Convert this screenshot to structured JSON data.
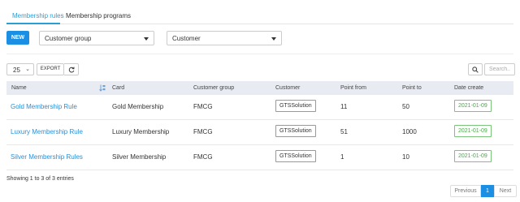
{
  "tabs": [
    {
      "label": "Membership rules",
      "active": true
    },
    {
      "label": "Membership programs",
      "active": false
    }
  ],
  "toolbar": {
    "new_label": "NEW",
    "customer_group_select": "Customer group",
    "customer_select": "Customer"
  },
  "table_controls": {
    "page_size": "25",
    "export_label": "EXPORT",
    "search_placeholder": "Search...",
    "refresh_icon": "refresh-icon",
    "search_icon": "search-icon"
  },
  "table": {
    "columns": [
      "Name",
      "Card",
      "Customer group",
      "Customer",
      "Point from",
      "Point to",
      "Date create"
    ],
    "sort_icon": "sort-alpha-icon",
    "rows": [
      {
        "name": "Gold Membership Rule",
        "card": "Gold Membership",
        "group": "FMCG",
        "customer": "GTSSolution",
        "point_from": "11",
        "point_to": "50",
        "date": "2021-01-09"
      },
      {
        "name": "Luxury Membership Rule",
        "card": "Luxury Membership",
        "group": "FMCG",
        "customer": "GTSSolution",
        "point_from": "51",
        "point_to": "1000",
        "date": "2021-01-09"
      },
      {
        "name": "Silver Membership Rules",
        "card": "Silver Membership",
        "group": "FMCG",
        "customer": "GTSSolution",
        "point_from": "1",
        "point_to": "10",
        "date": "2021-01-09"
      }
    ]
  },
  "footer": {
    "info": "Showing 1 to 3 of 3 entries",
    "previous": "Previous",
    "page": "1",
    "next": "Next"
  },
  "colors": {
    "accent": "#1a8fe3",
    "link": "#2a8fd6",
    "date_badge": "#4aa84a",
    "header_bg": "#e8ecf2"
  }
}
